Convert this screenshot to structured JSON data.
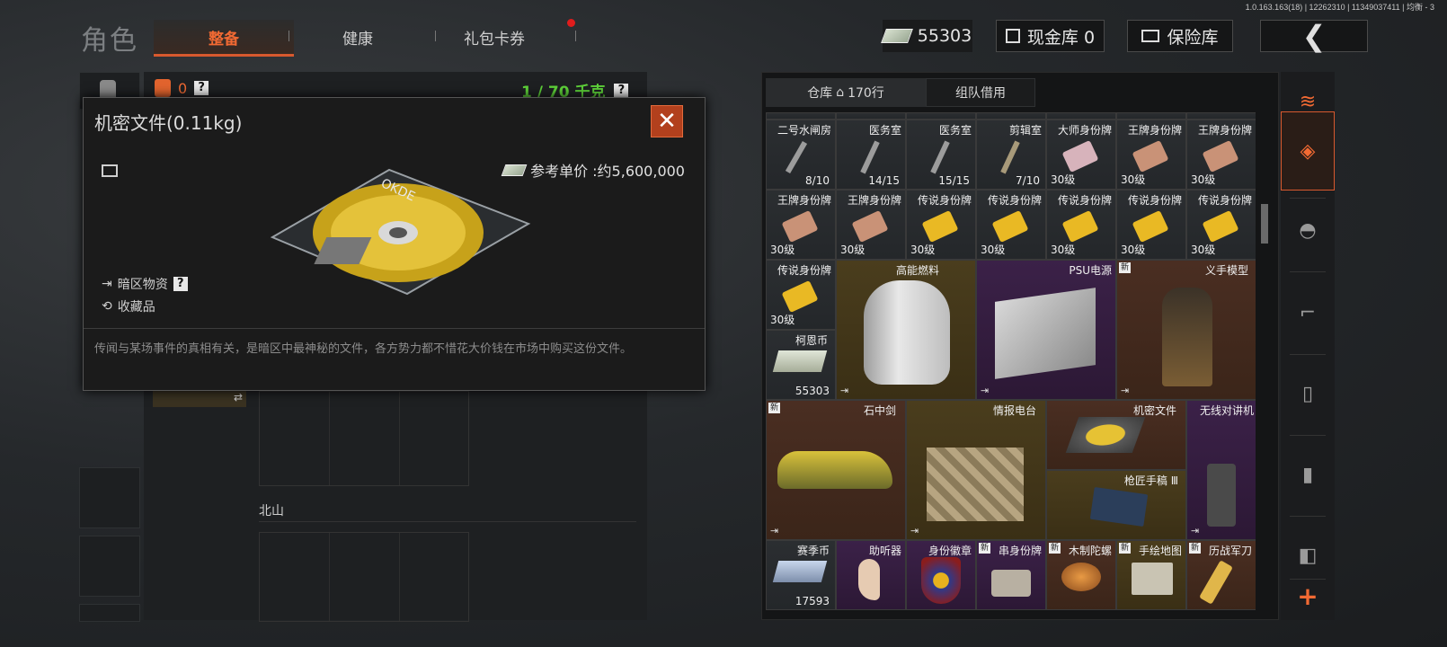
{
  "version": "1.0.163.163(18) | 12262310 | 11349037411 | 均衡 - 3",
  "header": {
    "role_label": "角色",
    "tabs": [
      {
        "label": "整备",
        "active": true
      },
      {
        "label": "健康",
        "active": false
      },
      {
        "label": "礼包卡券",
        "active": false
      }
    ],
    "cash_value": "55303",
    "cash_vault_label": "现金库 0",
    "safe_label": "保险库"
  },
  "left_panel": {
    "armor_count": "0",
    "weight": "1 / 70 千克",
    "section_label": "北山"
  },
  "tooltip": {
    "title": "机密文件(0.11kg)",
    "price_label": "参考单价 :约5,600,000",
    "tag_dark_zone": "暗区物资",
    "tag_collectible": "收藏品",
    "description": "传闻与某场事件的真相有关，是暗区中最神秘的文件，各方势力都不惜花大价钱在市场中购买这份文件。",
    "disc_text": "OKDE"
  },
  "warehouse": {
    "tab_storage": "仓库",
    "tab_rows": "170行",
    "tab_team": "组队借用",
    "items": [
      {
        "name": "二号水闸房",
        "value": "8/10",
        "color": "gray",
        "icon": "key-icon"
      },
      {
        "name": "医务室",
        "value": "14/15",
        "color": "gray",
        "icon": "key-icon"
      },
      {
        "name": "医务室",
        "value": "15/15",
        "color": "gray",
        "icon": "key-icon"
      },
      {
        "name": "剪辑室",
        "value": "7/10",
        "color": "gray",
        "icon": "key-icon"
      },
      {
        "name": "大师身份牌",
        "level": "30级",
        "color": "gray",
        "icon": "tag-icon"
      },
      {
        "name": "王牌身份牌",
        "level": "30级",
        "color": "gray",
        "icon": "tag-icon"
      },
      {
        "name": "王牌身份牌",
        "level": "30级",
        "color": "gray",
        "icon": "tag-icon"
      },
      {
        "name": "王牌身份牌",
        "level": "30级",
        "color": "gray",
        "icon": "tag-icon"
      },
      {
        "name": "王牌身份牌",
        "level": "30级",
        "color": "gray",
        "icon": "tag-icon"
      },
      {
        "name": "传说身份牌",
        "level": "30级",
        "color": "gray",
        "icon": "gold-tag-icon"
      },
      {
        "name": "传说身份牌",
        "level": "30级",
        "color": "gray",
        "icon": "gold-tag-icon"
      },
      {
        "name": "传说身份牌",
        "level": "30级",
        "color": "gray",
        "icon": "gold-tag-icon"
      },
      {
        "name": "传说身份牌",
        "level": "30级",
        "color": "gray",
        "icon": "gold-tag-icon"
      },
      {
        "name": "传说身份牌",
        "level": "30级",
        "color": "gray",
        "icon": "gold-tag-icon"
      },
      {
        "name": "传说身份牌",
        "level": "30级",
        "color": "gray",
        "icon": "gold-tag-icon"
      },
      {
        "name": "高能燃料",
        "color": "gold",
        "icon": "fuel-tank-icon"
      },
      {
        "name": "PSU电源",
        "color": "purple",
        "icon": "psu-icon"
      },
      {
        "name": "义手模型",
        "color": "red",
        "icon": "robot-hand-icon",
        "new": "新"
      },
      {
        "name": "柯恩币",
        "value": "55303",
        "color": "gray",
        "icon": "cash-icon"
      },
      {
        "name": "石中剑",
        "color": "red",
        "icon": "car-icon",
        "new": "新"
      },
      {
        "name": "情报电台",
        "color": "gold",
        "icon": "radio-box-icon"
      },
      {
        "name": "机密文件",
        "color": "red",
        "icon": "disc-icon"
      },
      {
        "name": "无线对讲机",
        "color": "purple",
        "icon": "walkie-talkie-icon"
      },
      {
        "name": "枪匠手稿 Ⅲ",
        "color": "gold",
        "icon": "manuscript-icon"
      },
      {
        "name": "赛季币",
        "value": "17593",
        "color": "gray",
        "icon": "season-coin-icon"
      },
      {
        "name": "助听器",
        "color": "purple",
        "icon": "hearing-aid-icon"
      },
      {
        "name": "身份徽章",
        "color": "purple",
        "icon": "badge-icon"
      },
      {
        "name": "串身份牌",
        "color": "purple",
        "icon": "dog-tags-icon",
        "new": "新"
      },
      {
        "name": "木制陀螺",
        "color": "red",
        "icon": "spinning-top-icon",
        "new": "新"
      },
      {
        "name": "手绘地图",
        "color": "gold",
        "icon": "map-icon",
        "new": "新"
      },
      {
        "name": "历战军刀",
        "color": "red",
        "icon": "knife-icon",
        "new": "新"
      }
    ]
  },
  "sidebar": {
    "add_label": "+"
  },
  "colors": {
    "accent": "#f26a33",
    "weight_green": "#5fd43a",
    "gray_cell": "#2b2e31",
    "gold_cell": "#4a3d1d",
    "purple_cell": "#3b2148",
    "red_cell": "#4a2e22"
  }
}
